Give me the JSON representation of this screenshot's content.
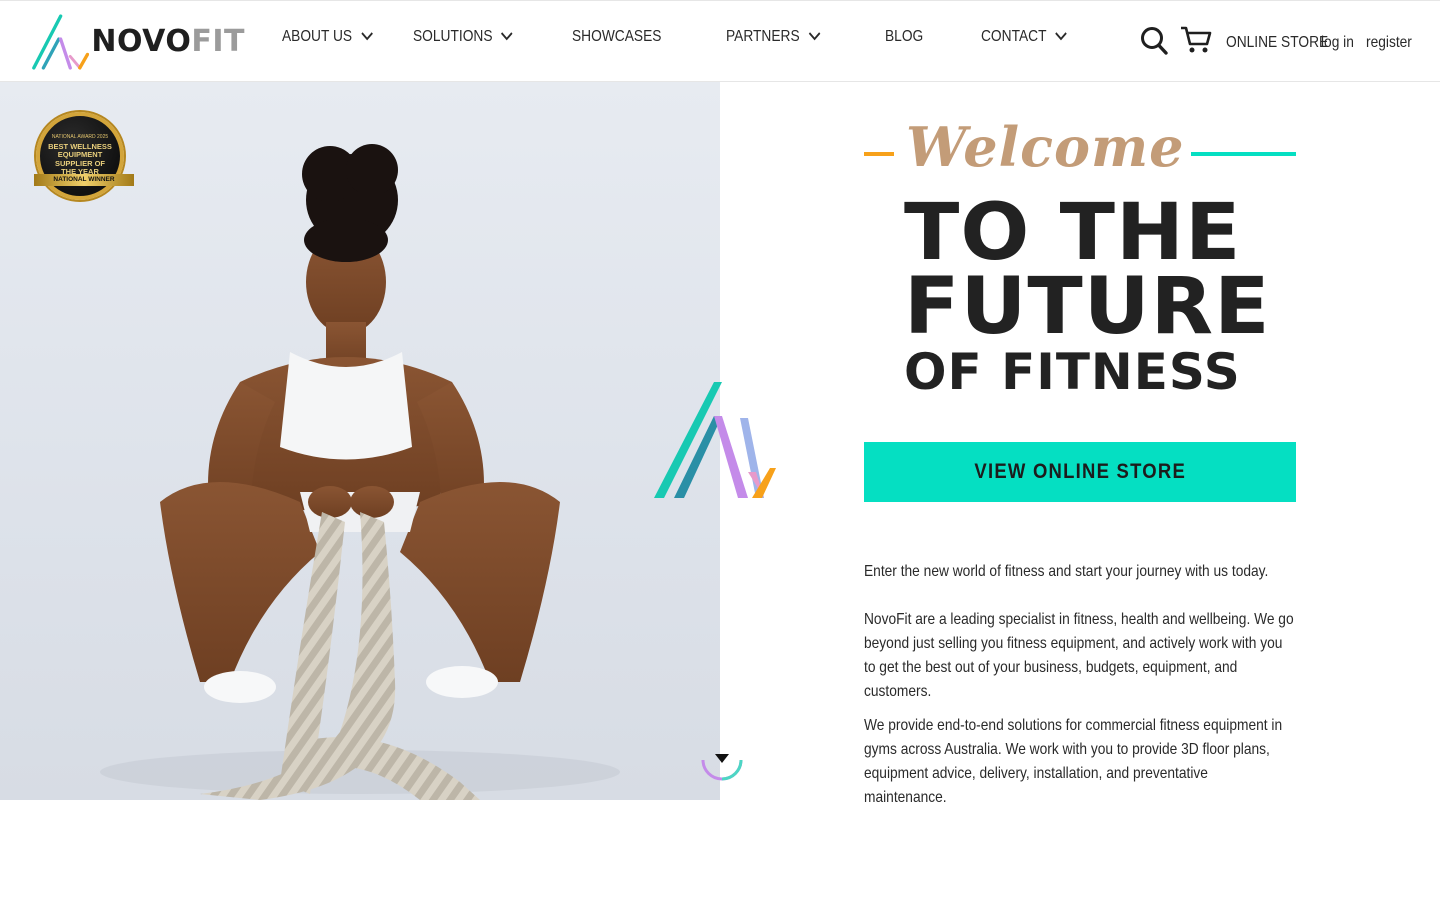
{
  "brand": {
    "name_part1": "NOVO",
    "name_part2": "FIT",
    "colors": {
      "teal": "#05dfc2",
      "orange": "#f7a11a",
      "purple": "#c48be9",
      "gold": "#d3a53a",
      "script": "#c39c78"
    }
  },
  "nav": {
    "items": [
      {
        "label": "ABOUT US",
        "has_dropdown": true
      },
      {
        "label": "SOLUTIONS",
        "has_dropdown": true
      },
      {
        "label": "SHOWCASES",
        "has_dropdown": false
      },
      {
        "label": "PARTNERS",
        "has_dropdown": true
      },
      {
        "label": "BLOG",
        "has_dropdown": false
      },
      {
        "label": "CONTACT",
        "has_dropdown": true
      }
    ],
    "search_icon": "search-icon",
    "cart_icon": "cart-icon",
    "online_store": "ONLINE STORE",
    "login": "log in",
    "register": "register"
  },
  "hero": {
    "image": "athlete-with-battle-ropes",
    "badge": {
      "top": "NATIONAL AWARD 2025",
      "main_lines": [
        "BEST WELLNESS",
        "EQUIPMENT",
        "SUPPLIER OF",
        "THE YEAR"
      ],
      "ribbon": "NATIONAL WINNER"
    },
    "scroll_icon": "scroll-down-icon"
  },
  "welcome": {
    "script": "Welcome",
    "line1": "TO THE",
    "line2": "FUTURE",
    "line3": "OF FITNESS",
    "cta": "VIEW ONLINE STORE"
  },
  "intro": {
    "p1": "Enter the new world of fitness and start your journey with us today.",
    "p2": "NovoFit are a leading specialist in fitness, health and wellbeing. We go beyond just selling you fitness equipment, and actively work with you to get the best out of your business, budgets, equipment, and customers.",
    "p3": "We provide end-to-end solutions for commercial fitness equipment in gyms across Australia. We work with you to provide 3D floor plans, equipment advice, delivery, installation, and preventative maintenance."
  }
}
